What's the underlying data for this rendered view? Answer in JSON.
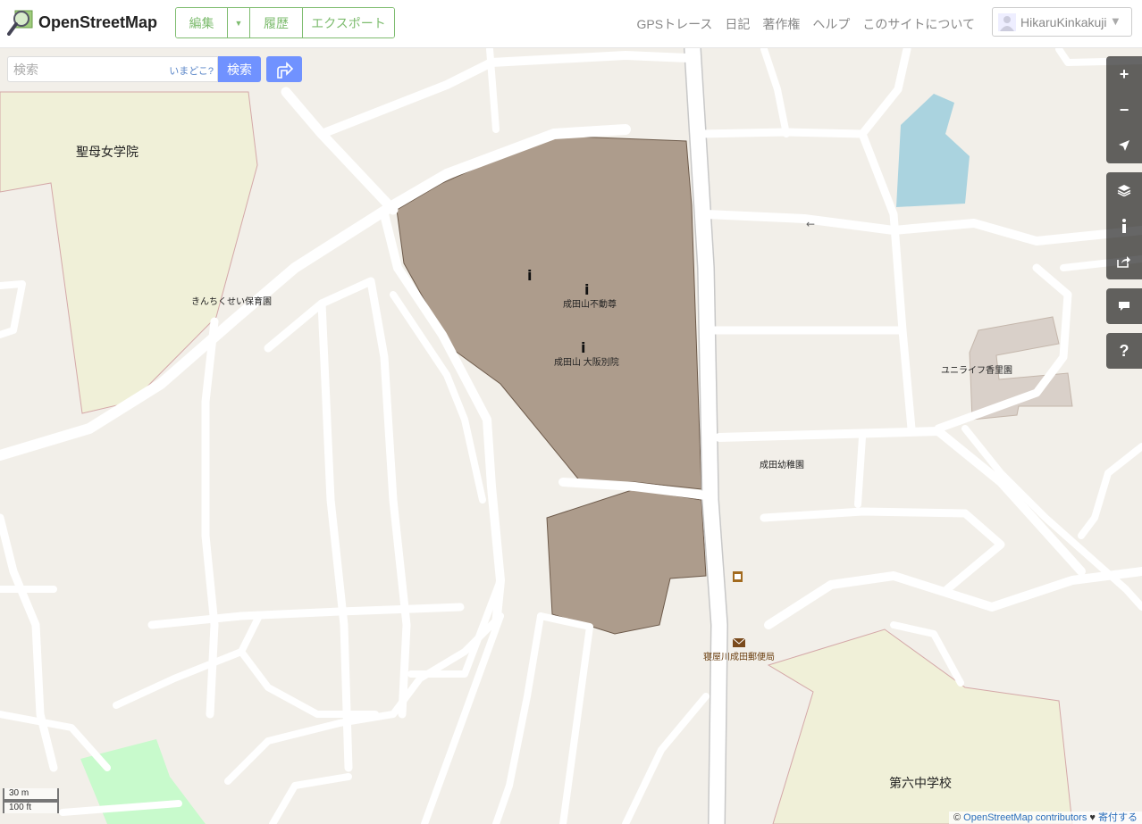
{
  "header": {
    "site_name": "OpenStreetMap",
    "edit_label": "編集",
    "history_label": "履歴",
    "export_label": "エクスポート",
    "nav": [
      "GPSトレース",
      "日記",
      "著作権",
      "ヘルプ",
      "このサイトについて"
    ],
    "username": "HikaruKinkakuji"
  },
  "search": {
    "placeholder": "検索",
    "where_am_i": "いまどこ?",
    "button": "検索"
  },
  "controls": {
    "zoom_in": "+",
    "zoom_out": "−",
    "help": "?"
  },
  "map_labels": {
    "school1": "聖母女学院",
    "nursery": "きんちくせい保育園",
    "temple1": "成田山不動尊",
    "temple2": "成田山 大阪別院",
    "kindergarten": "成田幼稚園",
    "care_home": "ユニライフ香里園",
    "post_office": "寝屋川成田郵便局",
    "school2": "第六中学校"
  },
  "scale": {
    "metric": "30 m",
    "imperial": "100 ft"
  },
  "attribution": {
    "prefix": "©",
    "link": "OpenStreetMap contributors",
    "heart": "♥",
    "donate": "寄付する"
  }
}
